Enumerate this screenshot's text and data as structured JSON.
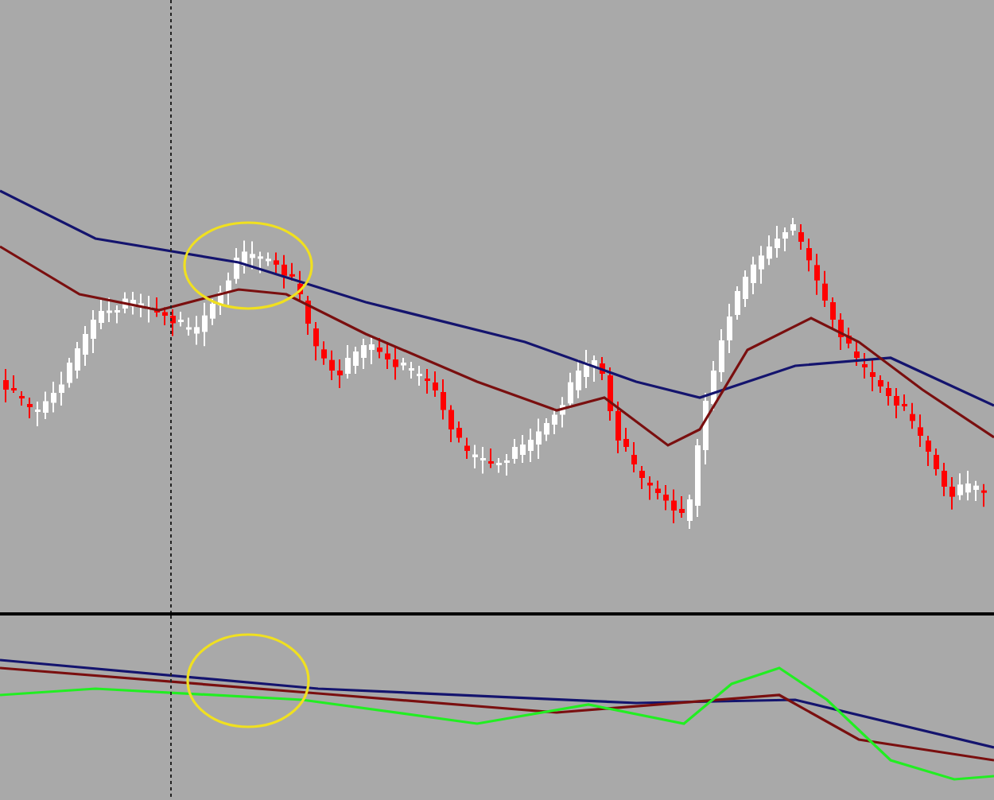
{
  "chart": {
    "panes": [
      {
        "kind": "candles"
      },
      {
        "kind": "oscillator"
      }
    ]
  }
}
